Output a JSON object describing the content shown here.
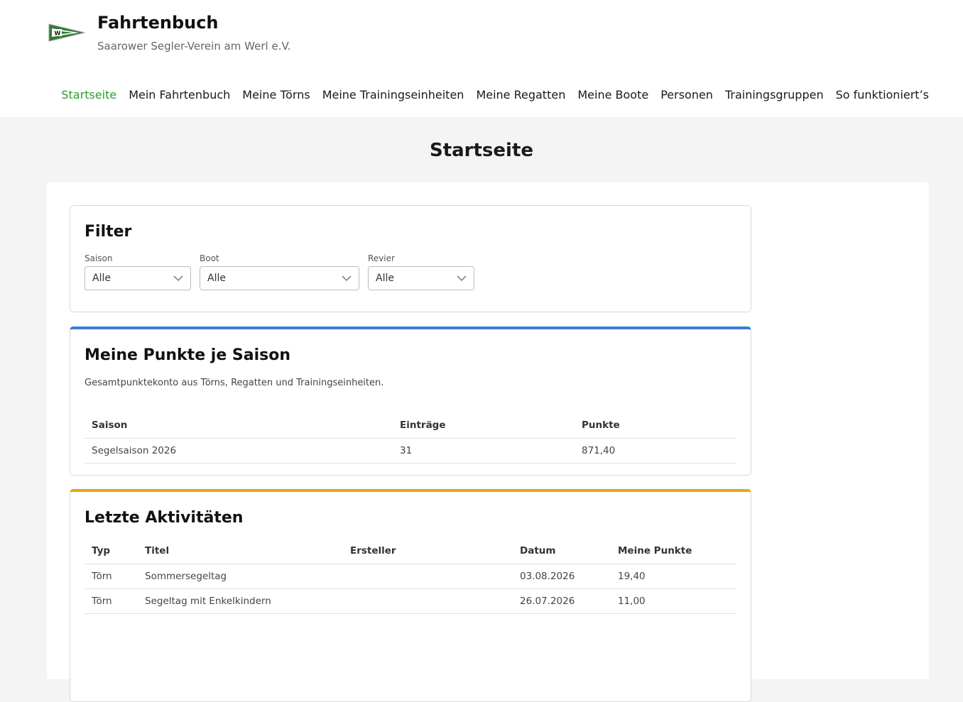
{
  "header": {
    "title": "Fahrtenbuch",
    "subtitle": "Saarower Segler-Verein am Werl e.V."
  },
  "nav": [
    {
      "label": "Startseite",
      "active": true
    },
    {
      "label": "Mein Fahrtenbuch"
    },
    {
      "label": "Meine Törns"
    },
    {
      "label": "Meine Trainingseinheiten"
    },
    {
      "label": "Meine Regatten"
    },
    {
      "label": "Meine Boote"
    },
    {
      "label": "Personen"
    },
    {
      "label": "Trainingsgruppen"
    },
    {
      "label": "So funktioniert’s"
    }
  ],
  "page_title": "Startseite",
  "filter": {
    "title": "Filter",
    "saison": {
      "label": "Saison",
      "value": "Alle"
    },
    "boot": {
      "label": "Boot",
      "value": "Alle"
    },
    "revier": {
      "label": "Revier",
      "value": "Alle"
    }
  },
  "points": {
    "title": "Meine Punkte je Saison",
    "description": "Gesamtpunktekonto aus Törns, Regatten und Trainingseinheiten.",
    "columns": [
      "Saison",
      "Einträge",
      "Punkte"
    ],
    "rows": [
      [
        "Segelsaison 2026",
        "31",
        "871,40"
      ]
    ]
  },
  "activities": {
    "title": "Letzte Aktivitäten",
    "columns": [
      "Typ",
      "Titel",
      "Ersteller",
      "Datum",
      "Meine Punkte"
    ],
    "rows": [
      [
        "Törn",
        "Sommersegeltag",
        "",
        "03.08.2026",
        "19,40"
      ],
      [
        "Törn",
        "Segeltag mit Enkelkindern",
        "",
        "26.07.2026",
        "11,00"
      ]
    ]
  },
  "colors": {
    "accent_green": "#2a9d2a",
    "blue_border": "#3b7dd8",
    "orange_border": "#e9a615"
  }
}
